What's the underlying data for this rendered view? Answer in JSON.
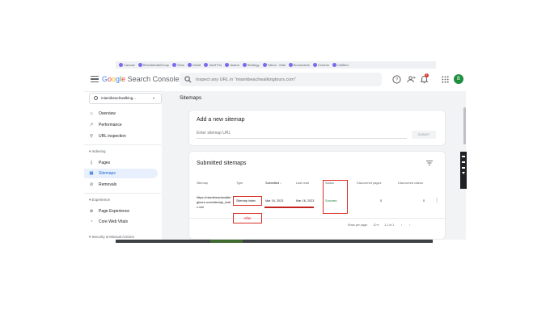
{
  "bookmarks": [
    "Canvas",
    "RhinoMediaGroup",
    "Vitus",
    "Gmail",
    "Jamf Pro",
    "Asana",
    "Strategy",
    "Yahoo · Mail",
    "Bookmarks",
    "Chrome",
    "Untitled"
  ],
  "brand": {
    "name": "Google Search Console",
    "g": "G",
    "o1": "o",
    "o2": "o",
    "g2": "g",
    "l": "l",
    "e": "e",
    "rest": " Search Console"
  },
  "search": {
    "placeholder": "Inspect any URL in \"miamibeachwalkingtours.com\""
  },
  "topbar": {
    "notification_count": "2",
    "avatar_letter": "B"
  },
  "property": {
    "label": "miamibeachwalking...",
    "caret": "▾"
  },
  "nav": {
    "overview": "Overview",
    "performance": "Performance",
    "url_inspection": "URL inspection",
    "section_indexing": "Indexing",
    "pages": "Pages",
    "sitemaps": "Sitemaps",
    "removals": "Removals",
    "section_experience": "Experience",
    "page_experience": "Page Experience",
    "core_web_vitals": "Core Web Vitals",
    "section_security": "Security & Manual Actions"
  },
  "main": {
    "page_title": "Sitemaps",
    "add": {
      "title": "Add a new sitemap",
      "placeholder": "Enter sitemap URL",
      "submit": "SUBMIT"
    },
    "submitted": {
      "title": "Submitted sitemaps",
      "columns": {
        "sitemap": "Sitemap",
        "type": "Type",
        "submitted": "Submitted",
        "last_read": "Last read",
        "status": "Status",
        "discovered_pages": "Discovered pages",
        "discovered_videos": "Discovered videos"
      },
      "row": {
        "sitemap": "https://miamibeachwalkingtours.com/sitemap_index.xml",
        "type": "Sitemap index",
        "submitted": "Mar 16, 2023",
        "last_read": "Mar 16, 2023",
        "status": "Success",
        "discovered_pages": "0",
        "discovered_videos": "0"
      },
      "footer": {
        "rows_per_page_label": "Rows per page:",
        "rows_per_page": "10",
        "range": "1-1 of 1"
      }
    }
  },
  "annotation": {
    "label": "After"
  },
  "colors": {
    "accent": "#1a73e8",
    "success": "#188038",
    "annotation": "#d93025",
    "active_nav_bg": "#e8f0fe"
  }
}
